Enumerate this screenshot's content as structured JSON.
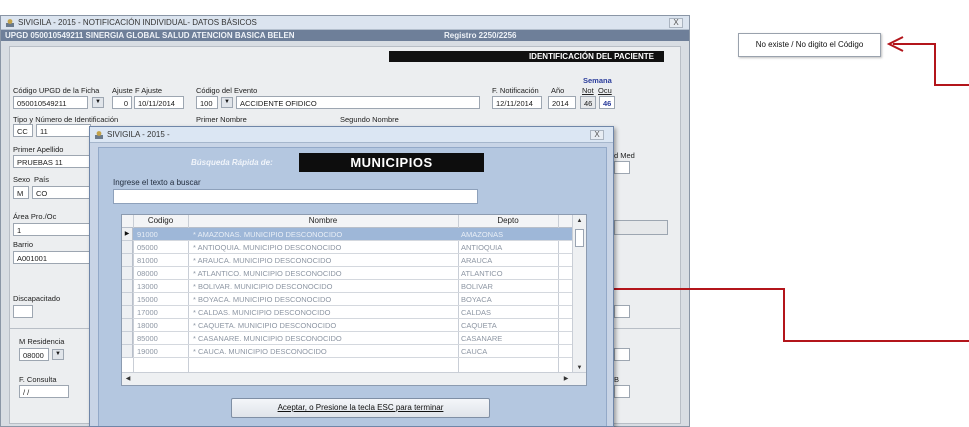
{
  "main_window": {
    "title": "SIVIGILA - 2015 -  NOTIFICACIÓN INDIVIDUAL- DATOS BÁSICOS",
    "close_label": "X",
    "header_band_left": "UPGD 050010549211 SINERGIA GLOBAL SALUD ATENCION BASICA BELEN",
    "header_band_right": "Registro 2250/2256",
    "section_title": "IDENTIFICACIÓN DEL PACIENTE",
    "labels": {
      "codigo_upgd": "Código UPGD de la Ficha",
      "ajuste": "Ajuste",
      "f_ajuste": "F Ajuste",
      "codigo_evento": "Código del Evento",
      "f_notificacion": "F. Notificación",
      "anio": "Año",
      "semana": "Semana",
      "not": "Not",
      "ocu": "Ocu",
      "tipo_numero": "Tipo y Número de Identificación",
      "primer_nombre": "Primer Nombre",
      "segundo_nombre": "Segundo Nombre",
      "primer_apellido": "Primer Apellido",
      "d_med": "d Med",
      "sexo": "Sexo",
      "pais": "País",
      "area_pro": "Área Pro./Oc",
      "barrio": "Barrio",
      "discapacitado": "Discapacitado",
      "m_residencia": "M Residencia",
      "f_consulta": "F. Consulta",
      "b": "B"
    },
    "values": {
      "codigo_upgd": "050010549211",
      "ajuste": "0",
      "f_ajuste": "10/11/2014",
      "codigo_evento": "100",
      "evento_nombre": "ACCIDENTE OFIDICO",
      "f_notificacion": "12/11/2014",
      "anio": "2014",
      "semana_not": "46",
      "semana_ocu": "46",
      "tipo_id": "CC",
      "numero_id": "11",
      "primer_apellido": "PRUEBAS 11",
      "sexo": "M",
      "pais": "CO",
      "area": "1",
      "barrio": "A001001",
      "m_residencia": "08000",
      "f_consulta": "/ /"
    }
  },
  "tooltip": {
    "text": "No existe / No digito el Código"
  },
  "dialog": {
    "title": "SIVIGILA - 2015 -",
    "close_label": "X",
    "quick_search_label": "Búsqueda Rápida de:",
    "quick_search_target": "MUNICIPIOS",
    "search_label": "Ingrese el texto a buscar",
    "search_value": "",
    "columns": {
      "codigo": "Codigo",
      "nombre": "Nombre",
      "depto": "Depto"
    },
    "rows": [
      {
        "codigo": "91000",
        "nombre": "* AMAZONAS. MUNICIPIO DESCONOCIDO",
        "depto": "AMAZONAS"
      },
      {
        "codigo": "05000",
        "nombre": "* ANTIOQUIA. MUNICIPIO DESCONOCIDO",
        "depto": "ANTIOQUIA"
      },
      {
        "codigo": "81000",
        "nombre": "* ARAUCA. MUNICIPIO DESCONOCIDO",
        "depto": "ARAUCA"
      },
      {
        "codigo": "08000",
        "nombre": "* ATLANTICO. MUNICIPIO DESCONOCIDO",
        "depto": "ATLANTICO"
      },
      {
        "codigo": "13000",
        "nombre": "* BOLIVAR. MUNICIPIO DESCONOCIDO",
        "depto": "BOLIVAR"
      },
      {
        "codigo": "15000",
        "nombre": "* BOYACA. MUNICIPIO DESCONOCIDO",
        "depto": "BOYACA"
      },
      {
        "codigo": "17000",
        "nombre": "* CALDAS. MUNICIPIO DESCONOCIDO",
        "depto": "CALDAS"
      },
      {
        "codigo": "18000",
        "nombre": "* CAQUETA. MUNICIPIO DESCONOCIDO",
        "depto": "CAQUETA"
      },
      {
        "codigo": "85000",
        "nombre": "* CASANARE. MUNICIPIO DESCONOCIDO",
        "depto": "CASANARE"
      },
      {
        "codigo": "19000",
        "nombre": "* CAUCA. MUNICIPIO DESCONOCIDO",
        "depto": "CAUCA"
      }
    ],
    "ok_button": "Aceptar, o Presione la tecla ESC para terminar"
  },
  "colors": {
    "arrow": "#b3151b",
    "selected_row": "#9eb7d8",
    "header_band": "#6e7f99",
    "dialog_frame": "#c8d4e6"
  },
  "icons": {
    "app_icon": "sivigila-app-icon",
    "close": "close-icon",
    "dropdown": "chevron-down-icon",
    "row_pointer": "row-pointer-icon",
    "arrow": "red-arrow-icon"
  }
}
